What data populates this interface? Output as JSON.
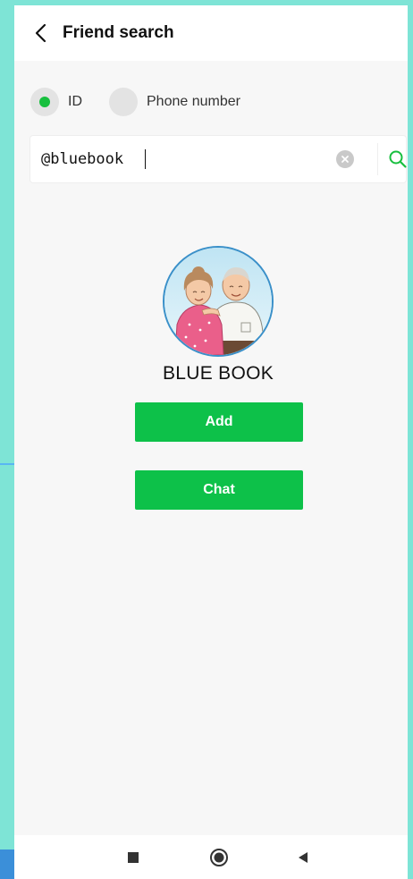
{
  "header": {
    "title": "Friend search",
    "back_icon": "chevron-left-icon"
  },
  "search_type": {
    "options": [
      {
        "label": "ID",
        "selected": true
      },
      {
        "label": "Phone number",
        "selected": false
      }
    ]
  },
  "search": {
    "value": "@bluebook",
    "clear_icon": "clear-icon",
    "search_icon": "search-icon"
  },
  "profile": {
    "name": "BLUE BOOK",
    "avatar_icon": "elderly-couple-avatar"
  },
  "actions": {
    "add_label": "Add",
    "chat_label": "Chat"
  },
  "nav": {
    "items": [
      "recent-apps-icon",
      "home-icon",
      "back-icon"
    ]
  },
  "colors": {
    "accent": "#0dc149",
    "radio_selected": "#17bf3e",
    "search_icon": "#17bf3e",
    "frame_background": "#7ee4d6"
  }
}
